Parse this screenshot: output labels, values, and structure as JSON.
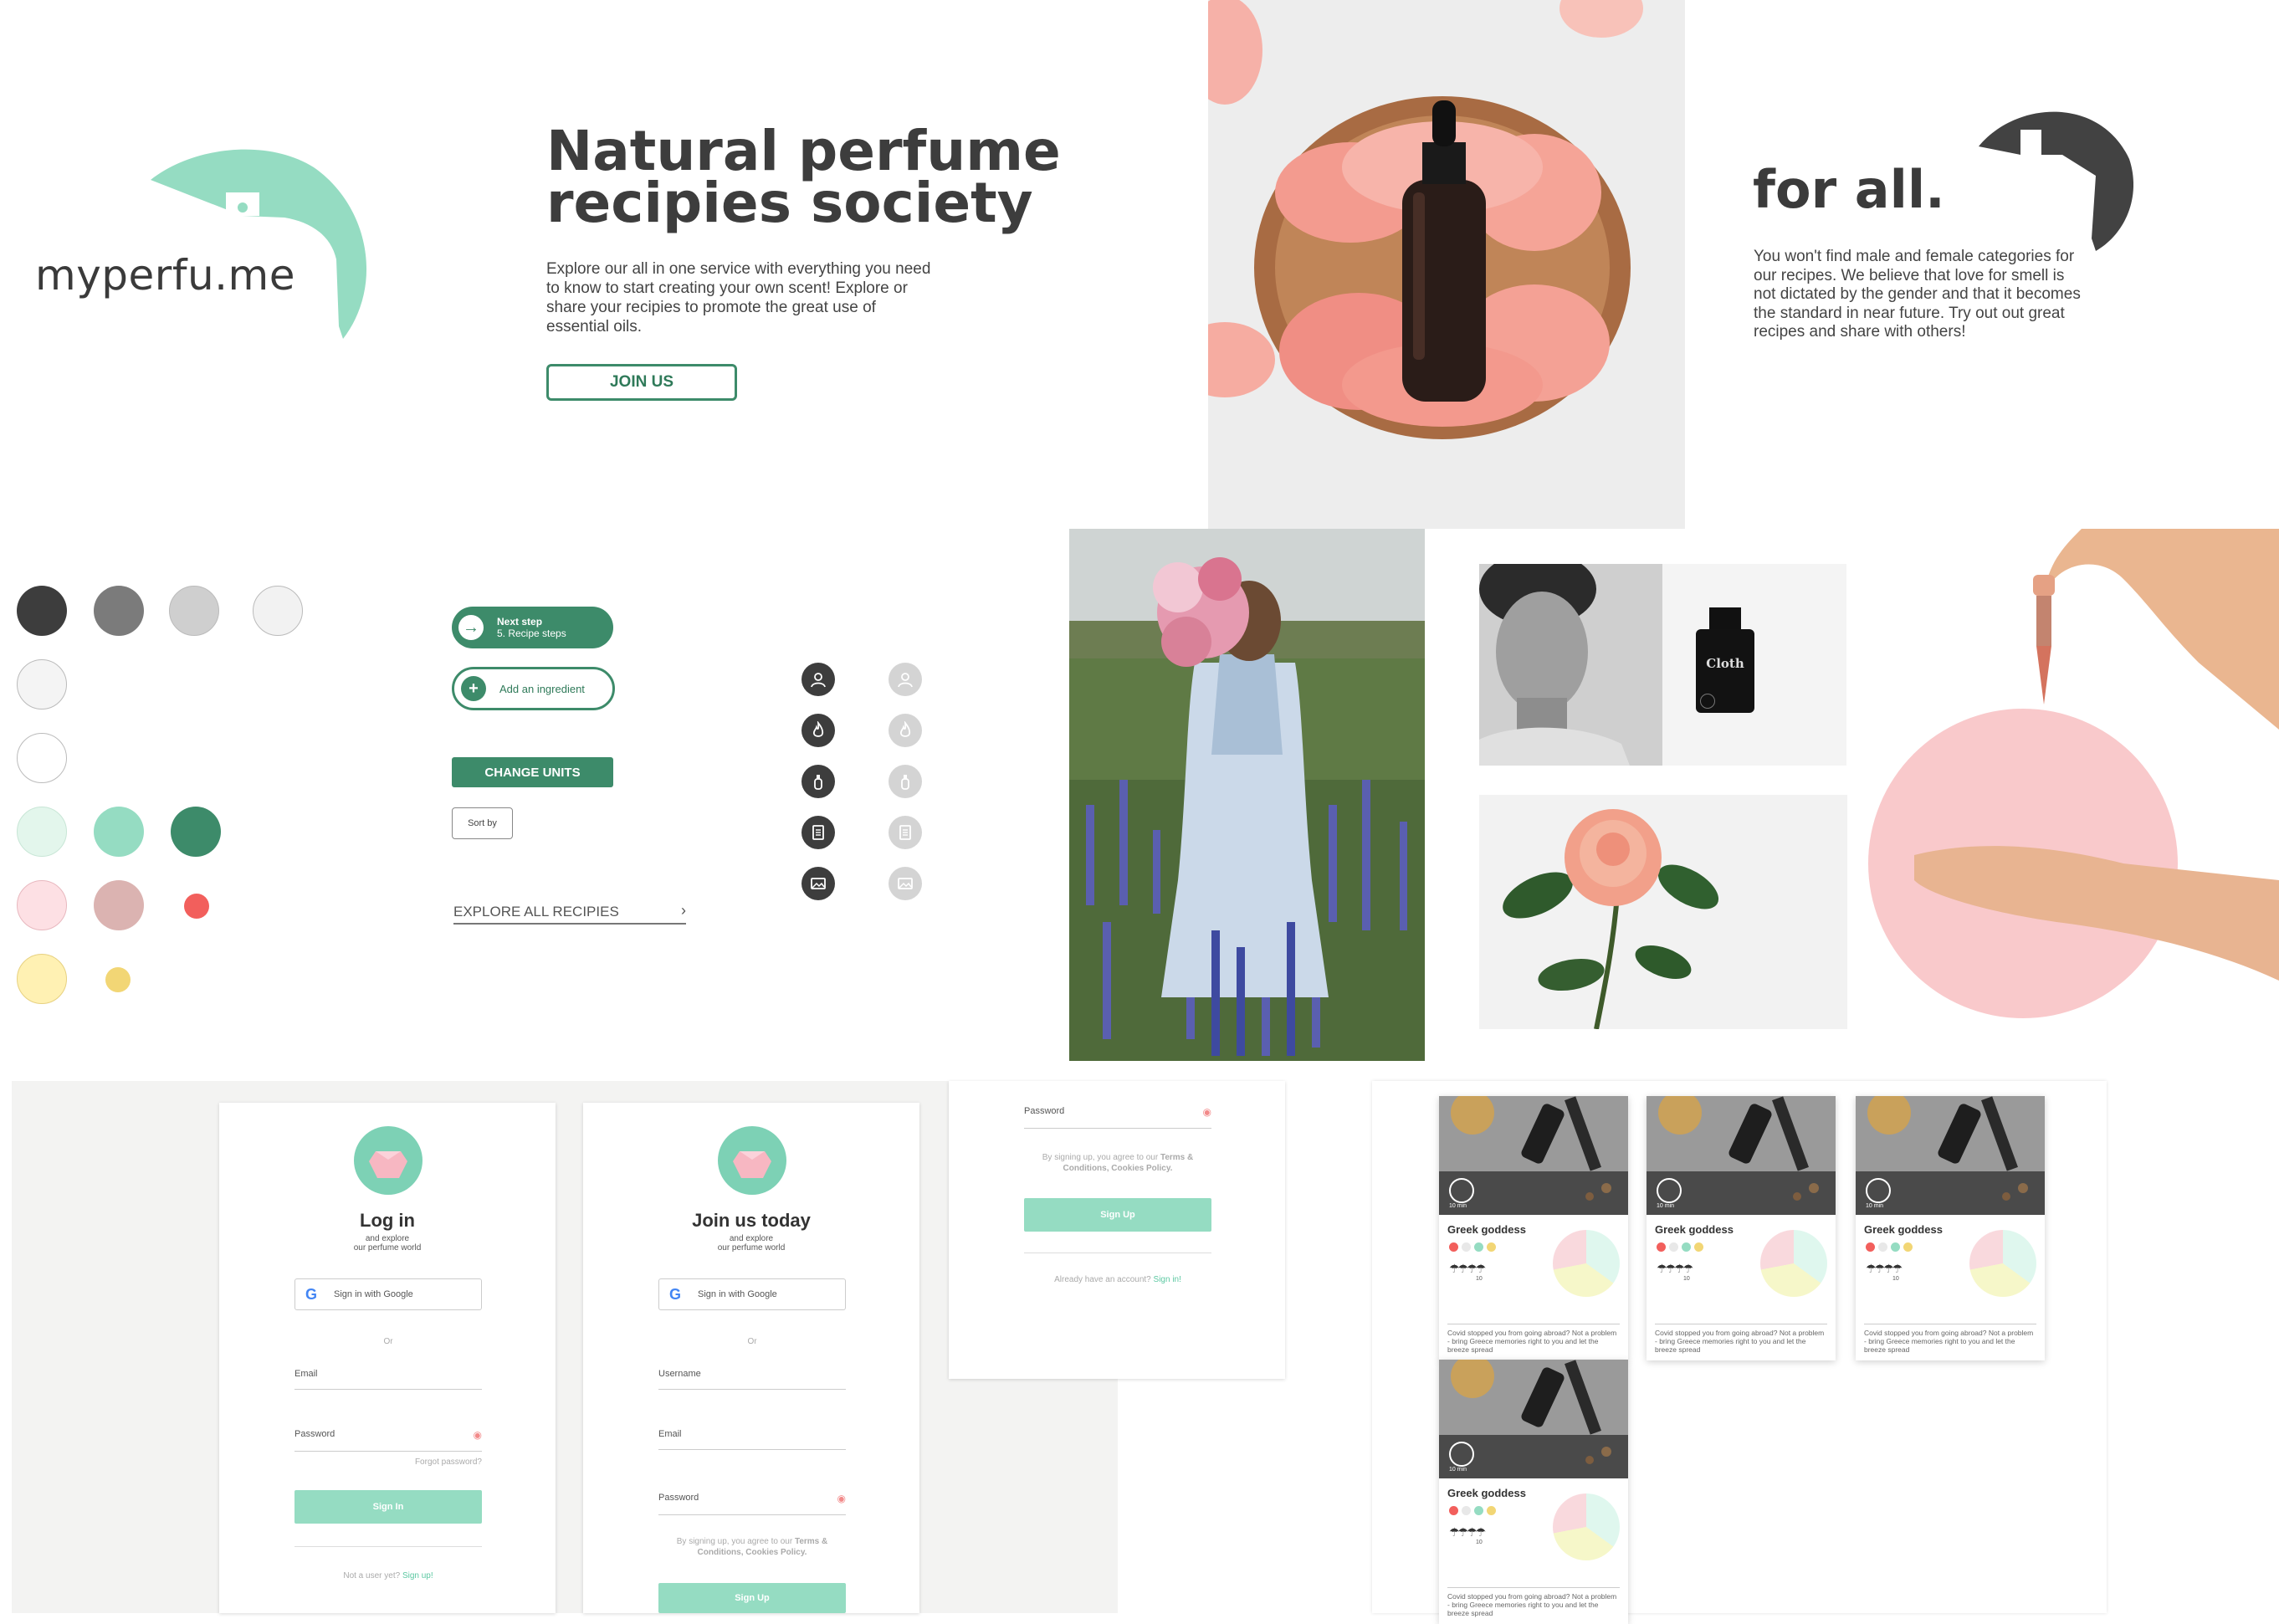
{
  "hero": {
    "brand": "myperfu.me",
    "title_line1": "Natural perfume",
    "title_line2": "recipies society",
    "description": "Explore our all in one service with everything you need to know to start creating your own scent! Explore or share your recipies to promote the great use of essential oils.",
    "cta_label": "JOIN US"
  },
  "forall": {
    "title": "for all.",
    "description": "You won't find male and female categories for our recipes. We believe that love for smell is not dictated by the gender and that it becomes the standard in near future. Try out out great recipes and share with others!"
  },
  "palette": {
    "colors": [
      "#3d3d3d",
      "#7b7b7b",
      "#cfcfcf",
      "#f2f2f2",
      "#f4f4f4",
      "#ffffff",
      "#e3f6ec",
      "#95dcc2",
      "#3d8b6a",
      "#fde0e4",
      "#dbb3b1",
      "#f25f5c",
      "#fff1b3",
      "#f2d675"
    ]
  },
  "components": {
    "next_step_label": "Next step",
    "next_step_sub": "5. Recipe steps",
    "add_ingredient_label": "Add an ingredient",
    "change_units_label": "CHANGE UNITS",
    "sort_by_label": "Sort by",
    "explore_label": "EXPLORE ALL RECIPIES",
    "icons": [
      "user-icon",
      "flame-icon",
      "bottle-icon",
      "document-icon",
      "image-icon"
    ]
  },
  "product": {
    "label": "Cloth"
  },
  "login": {
    "title": "Log in",
    "subtitle_1": "and explore",
    "subtitle_2": "our perfume world",
    "google_label": "Sign in with Google",
    "or_label": "Or",
    "email_label": "Email",
    "password_label": "Password",
    "forgot_label": "Forgot password?",
    "submit_label": "Sign In",
    "footer_prefix": "Not a user yet?",
    "footer_link": "Sign up!"
  },
  "signup": {
    "title": "Join us today",
    "subtitle_1": "and explore",
    "subtitle_2": "our perfume world",
    "google_label": "Sign in with Google",
    "or_label": "Or",
    "username_label": "Username",
    "email_label": "Email",
    "password_label": "Password",
    "terms_prefix": "By signing up, you agree to our",
    "terms_link": "Terms & Conditions, Cookies Policy.",
    "submit_label": "Sign Up"
  },
  "signup_cont": {
    "password_label": "Password",
    "terms_prefix": "By signing up, you agree to our",
    "terms_link": "Terms & Conditions, Cookies Policy.",
    "submit_label": "Sign Up",
    "footer_prefix": "Already have an account?",
    "footer_link": "Sign in!"
  },
  "cards": [
    {
      "title": "Greek goddess",
      "time": "10 min",
      "rating_count": "10",
      "description": "Covid stopped you from going abroad? Not a problem - bring Greece memories right to you and let the breeze spread"
    },
    {
      "title": "Greek goddess",
      "time": "10 min",
      "rating_count": "10",
      "description": "Covid stopped you from going abroad? Not a problem - bring Greece memories right to you and let the breeze spread"
    },
    {
      "title": "Greek goddess",
      "time": "10 min",
      "rating_count": "10",
      "description": "Covid stopped you from going abroad? Not a problem - bring Greece memories right to you and let the breeze spread"
    },
    {
      "title": "Greek goddess",
      "time": "10 min",
      "rating_count": "10",
      "description": "Covid stopped you from going abroad? Not a problem - bring Greece memories right to you and let the breeze spread"
    }
  ]
}
